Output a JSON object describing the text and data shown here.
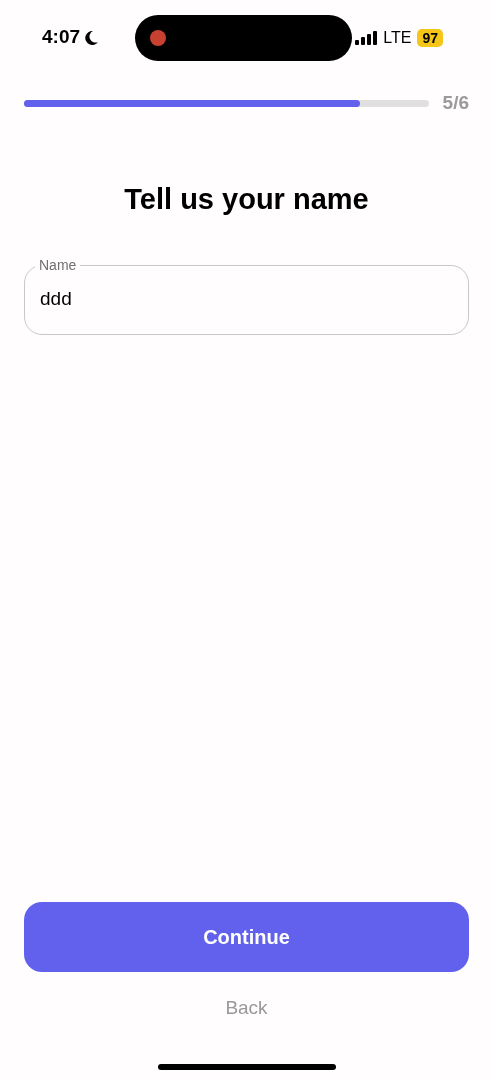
{
  "status_bar": {
    "time": "4:07",
    "network": "LTE",
    "battery": "97"
  },
  "progress": {
    "level": 0.83,
    "step": "5/6"
  },
  "title": "Tell us your name",
  "name_field": {
    "label": "Name",
    "value": "ddd"
  },
  "buttons": {
    "continue": "Continue",
    "back": "Back"
  }
}
